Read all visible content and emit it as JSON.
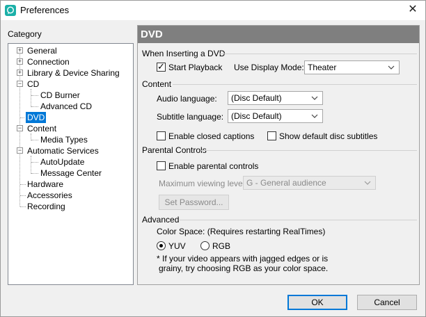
{
  "window": {
    "title": "Preferences",
    "close_glyph": "✕",
    "app_icon": "chat-bubble-icon"
  },
  "sidebar": {
    "label": "Category",
    "tree": [
      {
        "label": "General"
      },
      {
        "label": "Connection"
      },
      {
        "label": "Library & Device Sharing"
      },
      {
        "label": "CD"
      },
      {
        "label": "CD Burner"
      },
      {
        "label": "Advanced CD"
      },
      {
        "label": "DVD"
      },
      {
        "label": "Content"
      },
      {
        "label": "Media Types"
      },
      {
        "label": "Automatic Services"
      },
      {
        "label": "AutoUpdate"
      },
      {
        "label": "Message Center"
      },
      {
        "label": "Hardware"
      },
      {
        "label": "Accessories"
      },
      {
        "label": "Recording"
      }
    ],
    "selected": "DVD"
  },
  "panel": {
    "title": "DVD",
    "inserting": {
      "section": "When Inserting a DVD",
      "start_playback": "Start Playback",
      "start_playback_checked": true,
      "display_mode_label": "Use Display Mode:",
      "display_mode_value": "Theater"
    },
    "content": {
      "section": "Content",
      "audio_label": "Audio language:",
      "audio_value": "(Disc Default)",
      "subtitle_label": "Subtitle language:",
      "subtitle_value": "(Disc Default)",
      "closed_captions": "Enable closed captions",
      "closed_captions_checked": false,
      "default_subtitles": "Show default disc subtitles",
      "default_subtitles_checked": false
    },
    "parental": {
      "section": "Parental Controls",
      "enable": "Enable parental controls",
      "enable_checked": false,
      "max_level_label": "Maximum viewing level:",
      "max_level_value": "G - General audience",
      "set_password": "Set Password..."
    },
    "advanced": {
      "section": "Advanced",
      "color_space_label": "Color Space: (Requires restarting RealTimes)",
      "yuv": "YUV",
      "rgb": "RGB",
      "selected": "YUV",
      "note_line1": "* If your video appears with jagged edges or is",
      "note_line2": "grainy, try choosing RGB as your color space."
    }
  },
  "footer": {
    "ok": "OK",
    "cancel": "Cancel"
  }
}
